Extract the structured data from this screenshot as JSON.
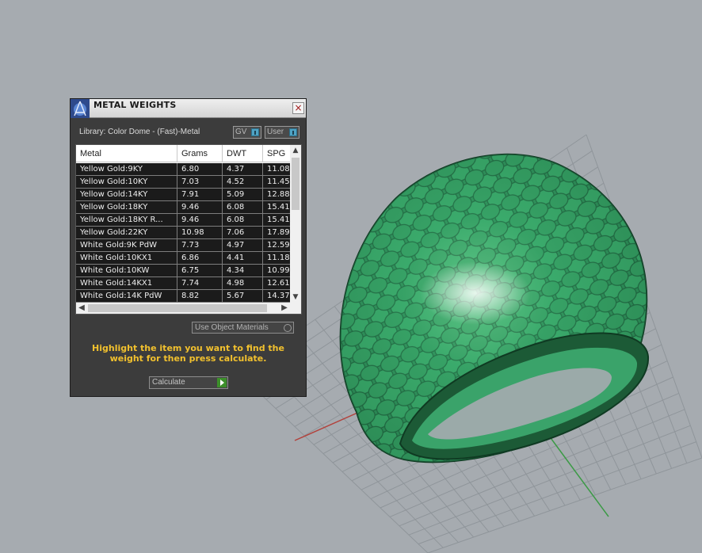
{
  "window": {
    "title": "METAL WEIGHTS",
    "close_icon": "×"
  },
  "library": {
    "label": "Library: Color Dome - (Fast)-Metal"
  },
  "toggles": {
    "gv": "GV",
    "user": "User"
  },
  "table": {
    "columns": [
      "Metal",
      "Grams",
      "DWT",
      "SPG"
    ],
    "rows": [
      [
        "Yellow Gold:9KY",
        "6.80",
        "4.37",
        "11.08"
      ],
      [
        "Yellow Gold:10KY",
        "7.03",
        "4.52",
        "11.45"
      ],
      [
        "Yellow Gold:14KY",
        "7.91",
        "5.09",
        "12.88"
      ],
      [
        "Yellow Gold:18KY",
        "9.46",
        "6.08",
        "15.41"
      ],
      [
        "Yellow Gold:18KY R...",
        "9.46",
        "6.08",
        "15.41"
      ],
      [
        "Yellow Gold:22KY",
        "10.98",
        "7.06",
        "17.89"
      ],
      [
        "White Gold:9K PdW",
        "7.73",
        "4.97",
        "12.59"
      ],
      [
        "White Gold:10KX1",
        "6.86",
        "4.41",
        "11.18"
      ],
      [
        "White Gold:10KW",
        "6.75",
        "4.34",
        "10.99"
      ],
      [
        "White Gold:14KX1",
        "7.74",
        "4.98",
        "12.61"
      ],
      [
        "White Gold:14K PdW",
        "8.82",
        "5.67",
        "14.37"
      ]
    ]
  },
  "use_object_materials": "Use Object Materials",
  "instruction": "Highlight the item you want to find the weight for then press calculate.",
  "calculate_button": "Calculate",
  "colors": {
    "viewport_bg": "#a6abb0",
    "ring_green": "#2f8f5a",
    "instruction_text": "#f2c12e",
    "panel_bg": "#3c3c3c"
  }
}
